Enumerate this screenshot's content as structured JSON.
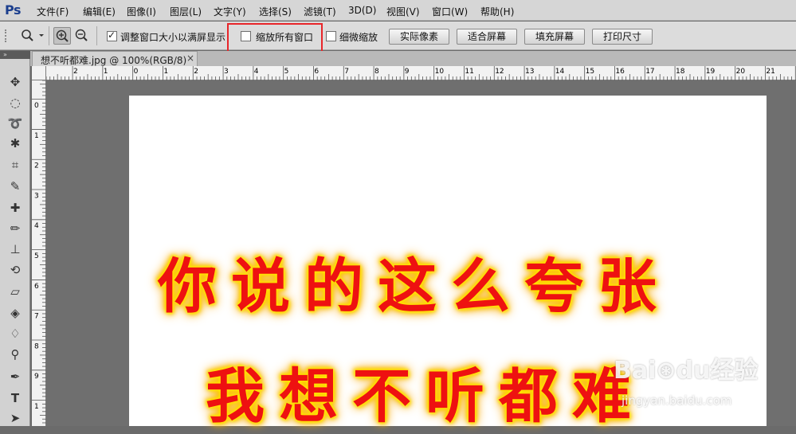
{
  "app": {
    "logo": "Ps"
  },
  "menu": {
    "items": [
      "文件(F)",
      "编辑(E)",
      "图像(I)",
      "图层(L)",
      "文字(Y)",
      "选择(S)",
      "滤镜(T)",
      "3D(D)",
      "视图(V)",
      "窗口(W)",
      "帮助(H)"
    ]
  },
  "options": {
    "resize_windows_label": "调整窗口大小以满屏显示",
    "resize_windows_checked": true,
    "zoom_all_windows_label": "缩放所有窗口",
    "zoom_all_windows_checked": false,
    "scrubby_zoom_label": "细微缩放",
    "scrubby_zoom_checked": false,
    "actual_pixels": "实际像素",
    "fit_screen": "适合屏幕",
    "fill_screen": "填充屏幕",
    "print_size": "打印尺寸"
  },
  "document": {
    "tab_title": "想不听都难.jpg @ 100%(RGB/8)",
    "tab_close": "×",
    "line1": "你说的这么夸张",
    "line2": "我想不听都难"
  },
  "rulers": {
    "top_labels": [
      "2",
      "1",
      "0",
      "1",
      "2",
      "3",
      "4",
      "5",
      "6",
      "7",
      "8",
      "9",
      "10",
      "11",
      "12",
      "13",
      "14",
      "15",
      "16",
      "17",
      "18",
      "19",
      "20",
      "21"
    ],
    "left_labels": [
      "0",
      "1",
      "2",
      "3",
      "4",
      "5",
      "6",
      "7",
      "8",
      "9",
      "1"
    ]
  },
  "watermark": {
    "brand": "Bai⊛du经验",
    "url": "jingyan.baidu.com"
  },
  "tools": [
    "move-tool-icon",
    "marquee-tool-icon",
    "lasso-tool-icon",
    "magic-wand-icon",
    "crop-tool-icon",
    "eyedropper-icon",
    "healing-brush-icon",
    "brush-tool-icon",
    "clone-stamp-icon",
    "history-brush-icon",
    "eraser-icon",
    "paint-bucket-icon",
    "blur-tool-icon",
    "dodge-tool-icon",
    "pen-tool-icon",
    "type-tool-icon",
    "path-select-icon"
  ],
  "colors": {
    "highlight": "#e8262a",
    "art_text": "#ee1111",
    "art_glow": "#ffee00"
  }
}
